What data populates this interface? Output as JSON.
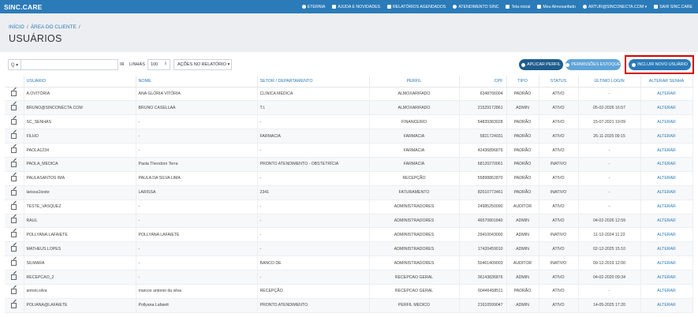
{
  "app": {
    "logo": "SINC.CARE"
  },
  "topnav": [
    {
      "label": "ETERNIA",
      "icon": "headset-icon"
    },
    {
      "label": "AJUDA E NOVIDADES",
      "icon": "rss-icon"
    },
    {
      "label": "RELATÓRIOS AGENDADOS",
      "icon": "report-icon"
    },
    {
      "label": "ATENDIMENTO SINC",
      "icon": "support-icon"
    },
    {
      "label": "Tela inicial",
      "icon": "screen-icon"
    },
    {
      "label": "Meu Almoxarifado",
      "icon": "edit-icon"
    },
    {
      "label": "ARTUR@SINCONECTA.COM ▾",
      "icon": "user-icon"
    },
    {
      "label": "SAIR SINC.CARE",
      "icon": "logout-icon"
    }
  ],
  "breadcrumb": [
    "INÍCIO",
    "ÁREA DO CLIENTE"
  ],
  "page_title": "USUÁRIOS",
  "toolbar": {
    "search_icon": "Q ▾",
    "search_value": "",
    "ir_label": "IR",
    "linhas_label": "LINHAS",
    "linhas_value": "100",
    "acoes_label": "AÇÕES NO RELATÓRIO ▾",
    "aplicar_label": "APLICAR PERFIL",
    "permissoes_label": "PERMISSÕES ESTOQUE",
    "incluir_label": "INCLUIR NOVO USUÁRIO"
  },
  "table": {
    "headers": [
      "",
      "USUÁRIO",
      "NOME",
      "SETOR / DEPARTAMENTO",
      "PERFIL",
      "CPF",
      "TIPO",
      "STATUS",
      "ÚLTIMO LOGIN",
      "ALTERAR SENHA"
    ],
    "rows": [
      [
        "A.OVITÓRIA",
        "ANA GLÓRIA VITÓRIA",
        "CLINICA MÉDICA",
        "ALMOXARIFADO",
        "6348766004",
        "PADRÃO",
        "ATIVO",
        "-",
        "ALTERAR"
      ],
      [
        "BRUNO@SINCONECTA.COM",
        "BRUNO CASELLAA",
        "T.I.",
        "ALMOXARIFADO",
        "21529172861",
        "ADMIN",
        "ATIVO",
        "05-02-2026 16:57",
        "ALTERAR"
      ],
      [
        "SC_SENHAS",
        "-",
        "-",
        "FINANCEIRO",
        "54839383028",
        "PADRÃO",
        "ATIVO",
        "15-07-2021 19:09",
        "ALTERAR"
      ],
      [
        "FILHO",
        "-",
        "FARMACIA",
        "FARMACIA",
        "5821724031",
        "PADRÃO",
        "ATIVO",
        "26-11-2025 09:15",
        "ALTERAR"
      ],
      [
        "PAOLA1234",
        "-",
        "-",
        "FARMACIA",
        "42436896879",
        "PADRÃO",
        "ATIVO",
        "-",
        "ALTERAR"
      ],
      [
        "PAOLA_MEDICA",
        "Paola Theodoro Terra",
        "PRONTO ATENDIMENTO - OBSTETRÍCIA",
        "FARMACIA",
        "68120270061",
        "PADRÃO",
        "INATIVO",
        "-",
        "ALTERAR"
      ],
      [
        "PAULASANTOS IMA",
        "PAULA DA SILVA LIMA",
        "-",
        "RECEPÇÃO",
        "55898862870",
        "PADRÃO",
        "ATIVO",
        "-",
        "ALTERAR"
      ],
      [
        "larissa1teste",
        "LARISSA",
        "2341",
        "FATURAMENTO",
        "82510773461",
        "PADRÃO",
        "INATIVO",
        "-",
        "ALTERAR"
      ],
      [
        "TESTE_VASQUEZ",
        "-",
        "-",
        "ADMINISTRADORES",
        "24985250090",
        "AUDITOR",
        "ATIVO",
        "-",
        "ALTERAR"
      ],
      [
        "RAUL",
        "-",
        "-",
        "ADMINISTRADORES",
        "46570801840",
        "ADMIN",
        "ATIVO",
        "04-02-2026 12:59",
        "ALTERAR"
      ],
      [
        "POLLYANA.LAFAIETE",
        "POLLYANA LAFAIETE",
        "-",
        "ADMINISTRADORES",
        "29410043000",
        "ADMIN",
        "INATIVO",
        "11-12-2024 11:22",
        "ALTERAR"
      ],
      [
        "MATHEUS.LOPES",
        "-",
        "-",
        "ADMINISTRADORES",
        "17420459010",
        "ADMIN",
        "ATIVO",
        "02-12-2025 15:10",
        "ALTERAR"
      ],
      [
        "SILMARA",
        "-",
        "BANCO DE",
        "ADMINISTRADORES",
        "50461409003",
        "AUDITOR",
        "INATIVO",
        "09-12-2019 12:00",
        "ALTERAR"
      ],
      [
        "RECEPCAO_2",
        "-",
        "-",
        "RECEPCAO GERAL",
        "36143836876",
        "ADMIN",
        "ATIVO",
        "04-02-2020 09:34",
        "ALTERAR"
      ],
      [
        "antoni.silva",
        "marcos antonio da silva",
        "RECEPÇÃO",
        "RECEPCAO GERAL",
        "60446458511",
        "PADRÃO",
        "ATIVO",
        "-",
        "ALTERAR"
      ],
      [
        "POLIANA@LAFAIETE",
        "Pollyana Lafaiett",
        "PRONTO ATENDIMENTO",
        "PERFIL MEDICO",
        "21610599047",
        "ADMIN",
        "ATIVO",
        "14-05-2025 17:20",
        "ALTERAR"
      ]
    ]
  }
}
